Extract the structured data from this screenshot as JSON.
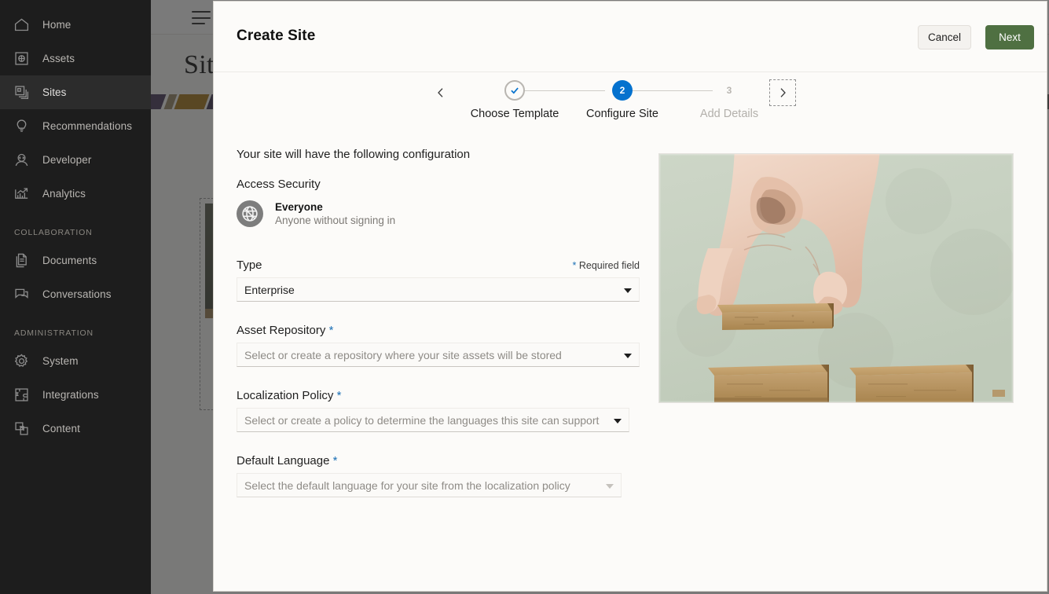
{
  "sidebar": {
    "items": [
      {
        "label": "Home",
        "icon": "home-icon",
        "active": false
      },
      {
        "label": "Assets",
        "icon": "assets-icon",
        "active": false
      },
      {
        "label": "Sites",
        "icon": "sites-icon",
        "active": true
      },
      {
        "label": "Recommendations",
        "icon": "lightbulb-icon",
        "active": false
      },
      {
        "label": "Developer",
        "icon": "developer-icon",
        "active": false
      },
      {
        "label": "Analytics",
        "icon": "analytics-icon",
        "active": false
      }
    ],
    "sections": [
      {
        "title": "COLLABORATION",
        "items": [
          {
            "label": "Documents",
            "icon": "document-icon"
          },
          {
            "label": "Conversations",
            "icon": "conversation-icon"
          }
        ]
      },
      {
        "title": "ADMINISTRATION",
        "items": [
          {
            "label": "System",
            "icon": "gear-icon"
          },
          {
            "label": "Integrations",
            "icon": "integrations-icon"
          },
          {
            "label": "Content",
            "icon": "content-icon"
          }
        ]
      }
    ]
  },
  "background_page": {
    "title": "Sites",
    "menu_icon": "hamburger-icon"
  },
  "modal": {
    "title": "Create Site",
    "cancel_label": "Cancel",
    "next_label": "Next",
    "accent_green": "#4f7042",
    "accent_blue": "#0572ce"
  },
  "stepper": {
    "prev_icon": "chevron-left-icon",
    "next_icon": "chevron-right-icon",
    "steps": [
      {
        "number": "1",
        "label": "Choose Template",
        "state": "done",
        "bullet": "✓"
      },
      {
        "number": "2",
        "label": "Configure Site",
        "state": "current",
        "bullet": "2"
      },
      {
        "number": "3",
        "label": "Add Details",
        "state": "todo",
        "bullet": "3"
      }
    ]
  },
  "form": {
    "intro": "Your site will have the following configuration",
    "access_security": {
      "heading": "Access Security",
      "icon": "globe-icon",
      "name": "Everyone",
      "description": "Anyone without signing in"
    },
    "required_note_star": "*",
    "required_note_text": " Required field",
    "fields": [
      {
        "label": "Type",
        "required": false,
        "value": "Enterprise",
        "is_placeholder": false,
        "caret": "caret-down-icon"
      },
      {
        "label": "Asset Repository",
        "required": true,
        "value": "Select or create a repository where your site assets will be stored",
        "is_placeholder": true,
        "caret": "caret-down-icon"
      },
      {
        "label": "Localization Policy",
        "required": true,
        "value": "Select or create a policy to determine the languages this site can support",
        "is_placeholder": true,
        "caret": "caret-down-icon"
      },
      {
        "label": "Default Language",
        "required": true,
        "value": "Select the default language for your site from the localization policy",
        "is_placeholder": true,
        "caret": "caret-down-icon"
      }
    ]
  },
  "illustration": {
    "alt": "hand-placing-wooden-block-photo",
    "background_color": "#c9d2c3"
  }
}
